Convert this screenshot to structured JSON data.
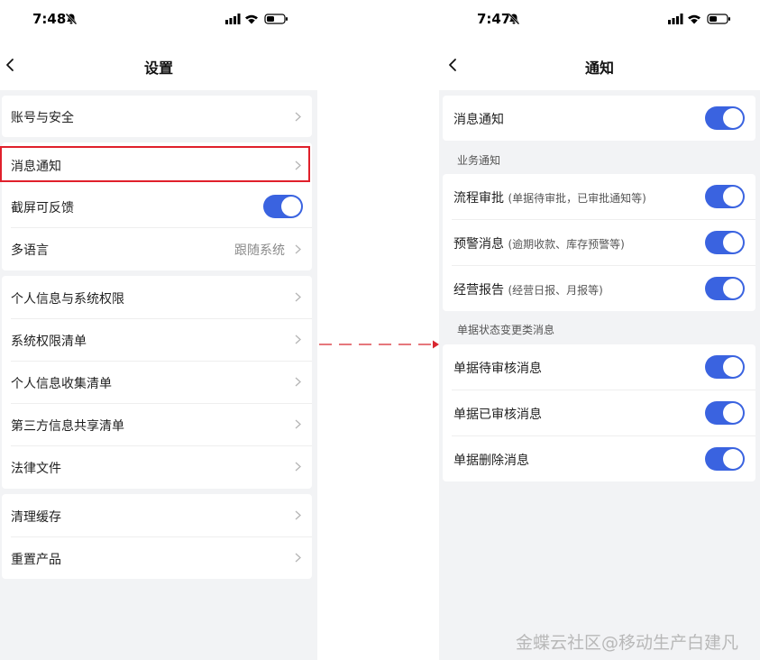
{
  "left_screen": {
    "status": {
      "time": "7:48"
    },
    "title": "设置",
    "group1": [
      {
        "label": "账号与安全"
      }
    ],
    "group2": [
      {
        "label": "消息通知"
      },
      {
        "label": "截屏可反馈"
      },
      {
        "label": "多语言",
        "value": "跟随系统"
      }
    ],
    "group3": [
      {
        "label": "个人信息与系统权限"
      },
      {
        "label": "系统权限清单"
      },
      {
        "label": "个人信息收集清单"
      },
      {
        "label": "第三方信息共享清单"
      },
      {
        "label": "法律文件"
      }
    ],
    "group4": [
      {
        "label": "清理缓存"
      },
      {
        "label": "重置产品"
      }
    ]
  },
  "right_screen": {
    "status": {
      "time": "7:47"
    },
    "title": "通知",
    "main_toggle": {
      "label": "消息通知"
    },
    "business_section": {
      "header": "业务通知",
      "items": [
        {
          "label": "流程审批",
          "sub": "(单据待审批，已审批通知等)"
        },
        {
          "label": "预警消息",
          "sub": "(逾期收款、库存预警等)"
        },
        {
          "label": "经营报告",
          "sub": "(经营日报、月报等)"
        }
      ]
    },
    "doc_section": {
      "header": "单据状态变更类消息",
      "items": [
        {
          "label": "单据待审核消息"
        },
        {
          "label": "单据已审核消息"
        },
        {
          "label": "单据删除消息"
        }
      ]
    }
  },
  "colors": {
    "toggle_on": "#3a63e0",
    "highlight": "#e0202b",
    "background": "#f2f3f5"
  },
  "watermark": "金蝶云社区@移动生产白建凡"
}
